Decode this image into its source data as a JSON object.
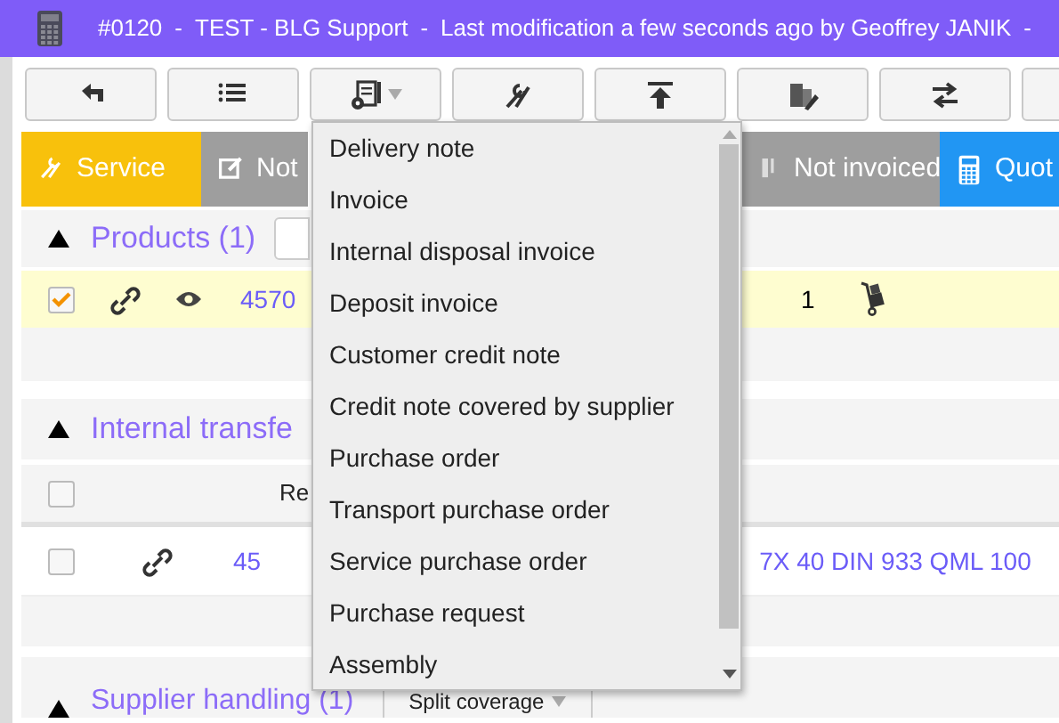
{
  "title_bar": {
    "number": "#0120",
    "separator_1": "-",
    "customer": "TEST - BLG Support",
    "separator_2": "-",
    "modification": "Last modification a few seconds ago by Geoffrey JANIK",
    "separator_3": "-"
  },
  "tabs": [
    {
      "kind": "service",
      "label": "Service",
      "color": "#f8c10c"
    },
    {
      "kind": "note",
      "label": "Not",
      "color": "#9e9e9e"
    },
    {
      "kind": "not_invoiced",
      "label": "Not invoiced",
      "color": "#9e9e9e"
    },
    {
      "kind": "quote",
      "label": "Quot",
      "color": "#2196f3"
    }
  ],
  "products": {
    "title": "Products (1)",
    "expanded": true,
    "rows": [
      {
        "checked": true,
        "reference": "4570",
        "quantity": "1"
      }
    ]
  },
  "internal_transfer": {
    "title": "Internal transfe",
    "expanded": true,
    "header": {
      "checked": false,
      "column_3": "Re"
    },
    "rows": [
      {
        "checked": false,
        "reference": "45",
        "description": "7X 40 DIN 933 QML 100"
      }
    ]
  },
  "supplier_handling": {
    "title": "Supplier handling (1)",
    "expanded": true,
    "button": "Split coverage"
  },
  "dropdown": {
    "items": [
      "Delivery note",
      "Invoice",
      "Internal disposal invoice",
      "Deposit invoice",
      "Customer credit note",
      "Credit note covered by supplier",
      "Purchase order",
      "Transport purchase order",
      "Service purchase order",
      "Purchase request",
      "Assembly"
    ]
  }
}
